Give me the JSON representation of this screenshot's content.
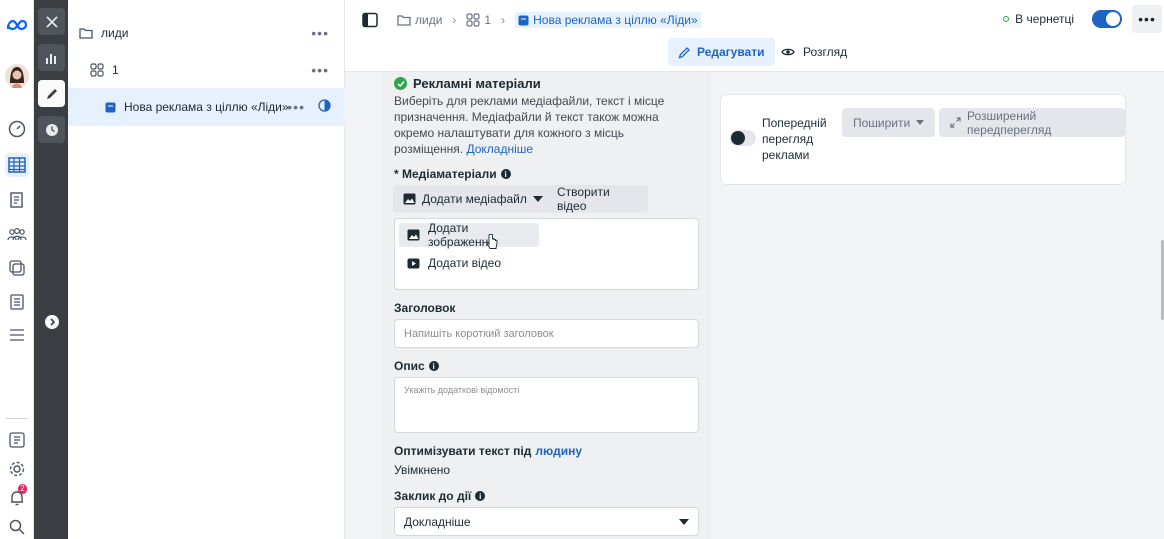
{
  "tree": {
    "campaign": "лиди",
    "adset": "1",
    "ad": "Нова реклама з ціллю «Ліди»"
  },
  "breadcrumb": {
    "campaign": "лиди",
    "adset": "1",
    "ad": "Нова реклама з ціллю «Ліди»"
  },
  "status": {
    "text": "В чернетці",
    "more": "•••"
  },
  "modes": {
    "edit": "Редагувати",
    "view": "Розгляд"
  },
  "creative": {
    "title": "Рекламні матеріали",
    "desc": "Виберіть для реклами медіафайли, текст і місце призначення. Медіафайли й текст також можна окремо налаштувати для кожного з місць розміщення.",
    "learn_more": "Докладніше",
    "media_label": "* Медіаматеріали",
    "add_media": "Додати медіафайл",
    "create_video": "Створити відео",
    "menu": {
      "add_image": "Додати зображення",
      "add_video": "Додати відео"
    },
    "headline_label": "Заголовок",
    "headline_placeholder": "Напишіть короткий заголовок",
    "desc_label": "Опис",
    "desc_placeholder": "Укажіть додаткові відомості",
    "optimize_label": "Оптимізувати текст під",
    "optimize_link": "людину",
    "optimize_value": "Увімкнено",
    "cta_label": "Заклик до дії",
    "cta_value": "Докладніше"
  },
  "preview": {
    "label": "Попередній перегляд реклами",
    "share": "Поширити",
    "advanced": "Розширений передперегляд"
  },
  "notifications_count": "2",
  "colors": {
    "accent": "#1d65c1",
    "success": "#2ea650",
    "strip": "#3b3f44"
  }
}
